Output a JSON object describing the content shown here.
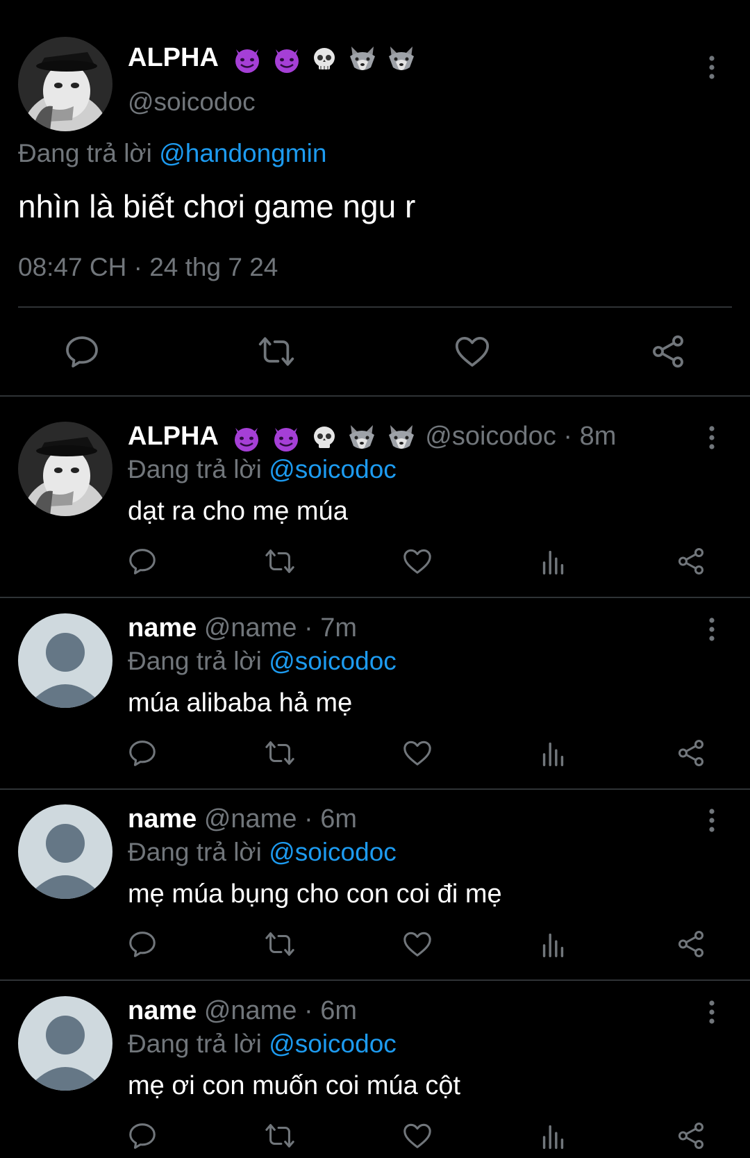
{
  "colors": {
    "background": "#000000",
    "text": "#e7e9ea",
    "muted": "#71767b",
    "link": "#1d9bf0",
    "divider": "#2f3336"
  },
  "main_tweet": {
    "display_name": "ALPHA",
    "name_emojis": [
      "smiling-devil-emoji",
      "smiling-devil-emoji",
      "skull-emoji",
      "wolf-emoji",
      "wolf-emoji"
    ],
    "handle": "@soicodoc",
    "replying_prefix": "Đang trả lời",
    "replying_to": "@handongmin",
    "text": "nhìn là biết chơi game ngu r",
    "timestamp": "08:47 CH · 24 thg 7 24",
    "actions": [
      "reply-icon",
      "retweet-icon",
      "like-icon",
      "share-icon"
    ]
  },
  "replies": [
    {
      "display_name": "ALPHA",
      "name_emojis": [
        "smiling-devil-emoji",
        "smiling-devil-emoji",
        "skull-emoji",
        "wolf-emoji",
        "wolf-emoji"
      ],
      "meta": "@soicodoc · 8m",
      "replying_prefix": "Đang trả lời",
      "replying_to": "@soicodoc",
      "text": "dạt ra cho mẹ múa",
      "avatar": "wolf-avatar"
    },
    {
      "display_name": "name",
      "meta": "@name · 7m",
      "replying_prefix": "Đang trả lời",
      "replying_to": "@soicodoc",
      "text": "múa alibaba hả mẹ",
      "avatar": "default-avatar"
    },
    {
      "display_name": "name",
      "meta": "@name · 6m",
      "replying_prefix": "Đang trả lời",
      "replying_to": "@soicodoc",
      "text": "mẹ múa bụng cho con coi đi mẹ",
      "avatar": "default-avatar"
    },
    {
      "display_name": "name",
      "meta": "@name · 6m",
      "replying_prefix": "Đang trả lời",
      "replying_to": "@soicodoc",
      "text": "mẹ ơi con muốn coi múa cột",
      "avatar": "default-avatar"
    }
  ],
  "reply_actions": [
    "reply-icon",
    "retweet-icon",
    "like-icon",
    "analytics-icon",
    "share-icon"
  ]
}
